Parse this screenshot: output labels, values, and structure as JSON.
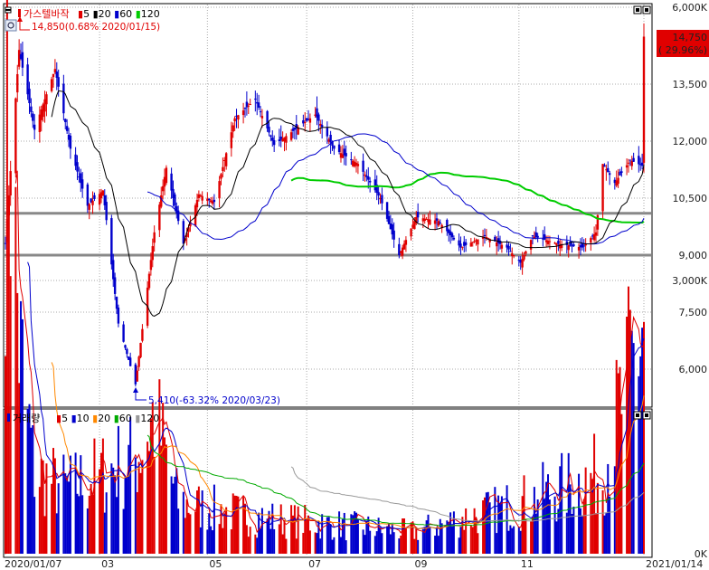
{
  "price_panel": {
    "title": "가스텔바작",
    "ma_legend": [
      {
        "label": "5",
        "color": "#e00000"
      },
      {
        "label": "20",
        "color": "#000000"
      },
      {
        "label": "60",
        "color": "#0000cc"
      },
      {
        "label": "120",
        "color": "#00cc00"
      }
    ],
    "high_annotation": "14,850(0.68% 2020/01/15)",
    "low_annotation": "5,410(-63.32% 2020/03/23)",
    "current_price": "14,750",
    "current_change": "( 29.96%)",
    "y_ticks": [
      "13,500",
      "12,000",
      "10,500",
      "9,000",
      "7,500",
      "6,000"
    ],
    "horizontal_lines": [
      10100,
      9000
    ]
  },
  "volume_panel": {
    "title": "거래량",
    "ma_legend": [
      {
        "label": "5",
        "color": "#e00000"
      },
      {
        "label": "10",
        "color": "#0000cc"
      },
      {
        "label": "20",
        "color": "#ff8800"
      },
      {
        "label": "60",
        "color": "#00aa00"
      },
      {
        "label": "120",
        "color": "#999999"
      }
    ],
    "y_ticks": [
      "6,000K",
      "3,000K",
      "0K"
    ]
  },
  "x_ticks": [
    "2020/01/07",
    "03",
    "05",
    "07",
    "09",
    "11",
    "2021/01/14"
  ],
  "colors": {
    "up": "#e00000",
    "down": "#0000cc",
    "ma5": "#e00000",
    "ma20": "#000000",
    "ma60": "#0000cc",
    "ma120": "#00cc00",
    "hline": "#888888"
  },
  "chart_data": {
    "type": "candlestick",
    "price_axis": {
      "ylim": [
        5000,
        15000
      ],
      "ticks": [
        13500,
        12000,
        10500,
        9000,
        7500,
        6000
      ]
    },
    "volume_axis": {
      "ylim": [
        0,
        6800
      ],
      "unit": "K",
      "ticks": [
        6000,
        3000,
        0
      ]
    },
    "price_anchors": [
      [
        "2020/01/07",
        9300
      ],
      [
        "2020/01/15",
        14400
      ],
      [
        "2020/01/24",
        12300
      ],
      [
        "2020/02/05",
        13900
      ],
      [
        "2020/02/14",
        11800
      ],
      [
        "2020/02/24",
        10300
      ],
      [
        "2020/03/04",
        10700
      ],
      [
        "2020/03/13",
        7200
      ],
      [
        "2020/03/23",
        5600
      ],
      [
        "2020/04/03",
        9600
      ],
      [
        "2020/04/10",
        11300
      ],
      [
        "2020/04/20",
        9300
      ],
      [
        "2020/04/29",
        10600
      ],
      [
        "2020/05/08",
        10400
      ],
      [
        "2020/05/20",
        12600
      ],
      [
        "2020/06/01",
        13100
      ],
      [
        "2020/06/12",
        11900
      ],
      [
        "2020/06/24",
        12300
      ],
      [
        "2020/07/06",
        12700
      ],
      [
        "2020/07/17",
        11800
      ],
      [
        "2020/07/31",
        11400
      ],
      [
        "2020/08/13",
        10500
      ],
      [
        "2020/08/24",
        9000
      ],
      [
        "2020/09/03",
        10000
      ],
      [
        "2020/09/16",
        9900
      ],
      [
        "2020/09/29",
        9200
      ],
      [
        "2020/10/13",
        9500
      ],
      [
        "2020/10/26",
        9200
      ],
      [
        "2020/11/03",
        8800
      ],
      [
        "2020/11/10",
        9500
      ],
      [
        "2020/11/25",
        9300
      ],
      [
        "2020/12/09",
        9200
      ],
      [
        "2020/12/17",
        9600
      ],
      [
        "2020/12/21",
        11400
      ],
      [
        "2020/12/28",
        10900
      ],
      [
        "2021/01/06",
        11500
      ],
      [
        "2021/01/13",
        11350
      ],
      [
        "2021/01/14",
        14750
      ]
    ],
    "volume_anchors": [
      [
        "2020/01/09",
        6200
      ],
      [
        "2020/01/15",
        2900
      ],
      [
        "2020/01/24",
        1100
      ],
      [
        "2020/02/12",
        900
      ],
      [
        "2020/03/23",
        1300
      ],
      [
        "2020/04/03",
        1900
      ],
      [
        "2020/04/17",
        700
      ],
      [
        "2020/06/02",
        500
      ],
      [
        "2020/09/01",
        300
      ],
      [
        "2020/11/03",
        700
      ],
      [
        "2020/12/21",
        1100
      ],
      [
        "2021/01/14",
        3200
      ]
    ]
  }
}
